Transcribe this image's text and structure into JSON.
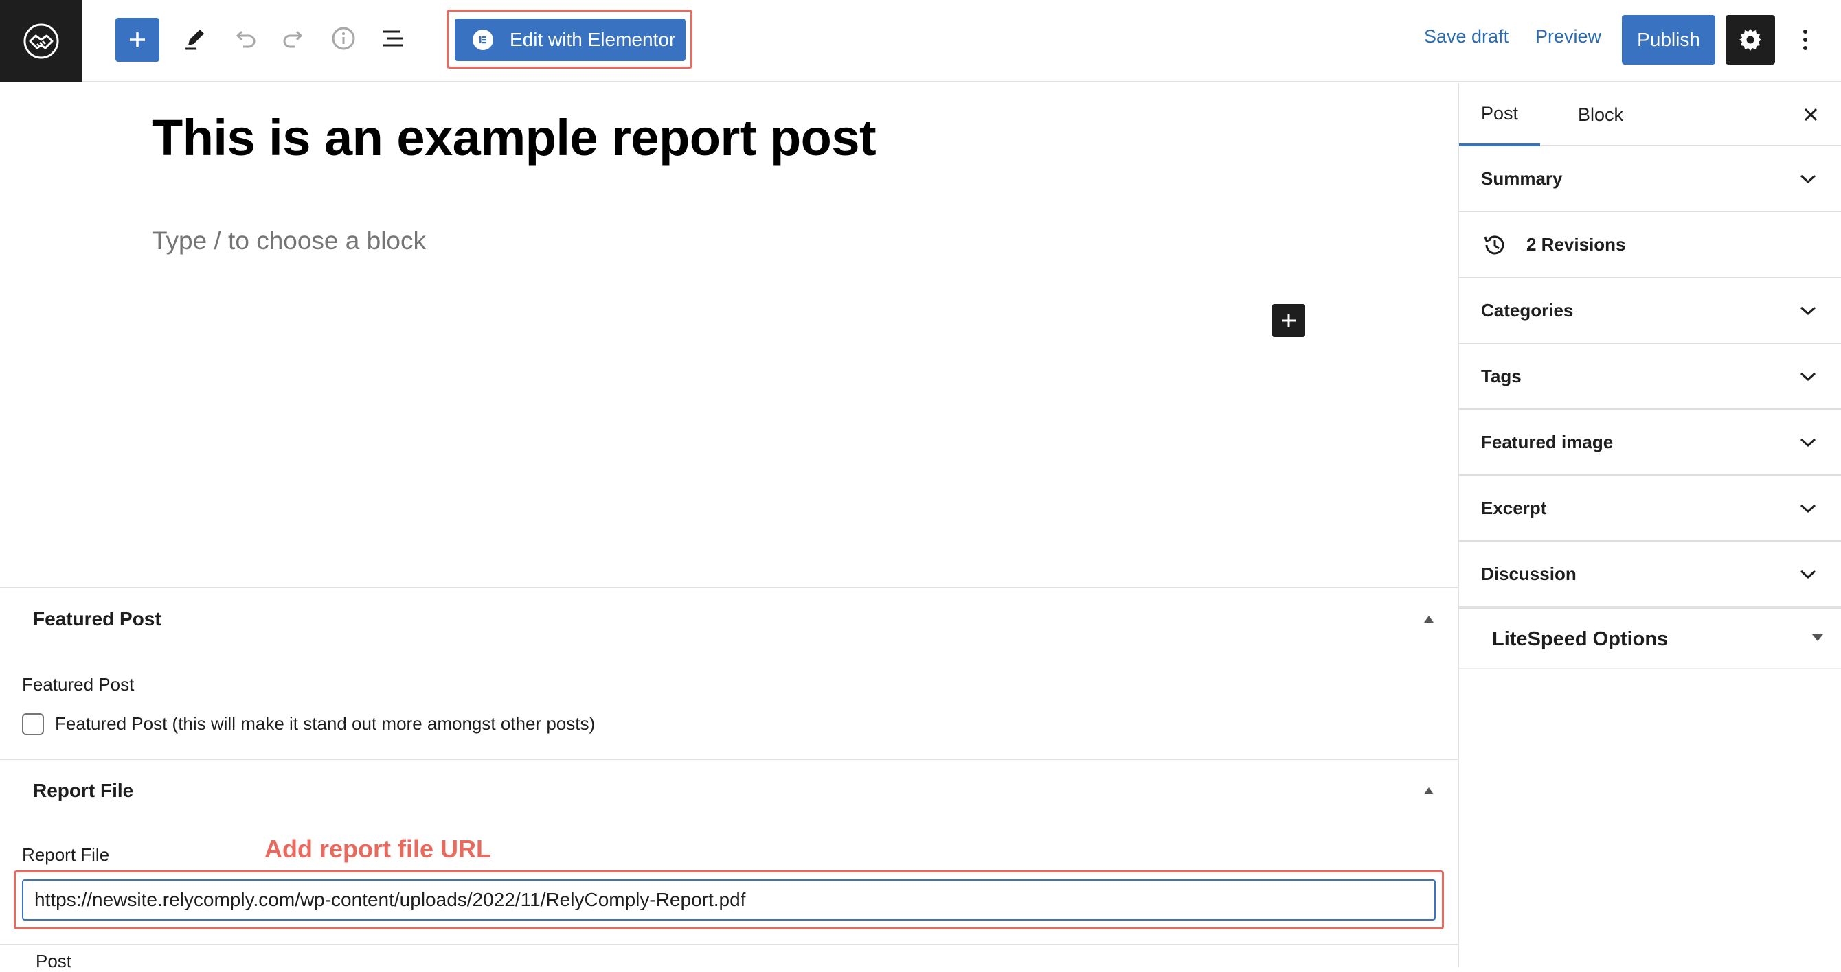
{
  "toolbar": {
    "icons": {
      "site_logo": "handshake-logo-icon",
      "inserter": "plus-icon",
      "tools": "pencil-icon",
      "undo": "undo-icon",
      "redo": "redo-icon",
      "details": "info-icon",
      "list_view": "list-view-icon",
      "settings": "gear-icon",
      "options": "more-vertical-icon"
    },
    "elementor_label": "Edit with Elementor",
    "save_draft_label": "Save draft",
    "preview_label": "Preview",
    "publish_label": "Publish"
  },
  "editor": {
    "post_title": "This is an example report post",
    "block_placeholder": "Type / to choose a block"
  },
  "metaboxes": {
    "featured_post": {
      "heading": "Featured Post",
      "field_label": "Featured Post",
      "checkbox_label": "Featured Post (this will make it stand out more amongst other posts)",
      "checked": false
    },
    "report_file": {
      "heading": "Report File",
      "field_label": "Report File",
      "annotation": "Add report file URL",
      "url_value": "https://newsite.relycomply.com/wp-content/uploads/2022/11/RelyComply-Report.pdf"
    }
  },
  "footer": {
    "breadcrumb": "Post"
  },
  "sidebar": {
    "tabs": [
      "Post",
      "Block"
    ],
    "active_tab": "Post",
    "revisions_label": "2 Revisions",
    "panels": [
      "Summary",
      "Categories",
      "Tags",
      "Featured image",
      "Excerpt",
      "Discussion"
    ],
    "litespeed_label": "LiteSpeed Options"
  },
  "colors": {
    "accent": "#3872c0",
    "annotation": "#e86a5e",
    "dark": "#1e1e1e"
  }
}
